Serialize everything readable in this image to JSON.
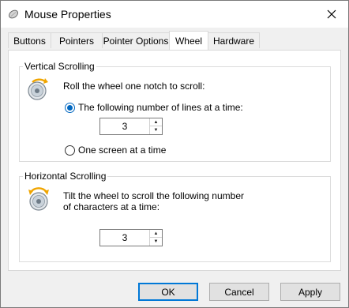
{
  "window": {
    "title": "Mouse Properties"
  },
  "tabs": [
    {
      "label": "Buttons",
      "active": false
    },
    {
      "label": "Pointers",
      "active": false
    },
    {
      "label": "Pointer Options",
      "active": false
    },
    {
      "label": "Wheel",
      "active": true
    },
    {
      "label": "Hardware",
      "active": false
    }
  ],
  "vertical": {
    "group_label": "Vertical Scrolling",
    "instruction": "Roll the wheel one notch to scroll:",
    "option_lines": {
      "label": "The following number of lines at a time:",
      "selected": true
    },
    "lines_value": "3",
    "option_screen": {
      "label": "One screen at a time",
      "selected": false
    }
  },
  "horizontal": {
    "group_label": "Horizontal Scrolling",
    "instruction_line1": "Tilt the wheel to scroll the following number",
    "instruction_line2": "of characters at a time:",
    "chars_value": "3"
  },
  "buttons": {
    "ok": "OK",
    "cancel": "Cancel",
    "apply": "Apply"
  },
  "icons": {
    "title": "mouse-icon",
    "close": "close-icon",
    "wheel": "scroll-wheel-icon",
    "spin_up": "spin-up-arrow-icon",
    "spin_down": "spin-down-arrow-icon"
  },
  "colors": {
    "accent": "#0067c0",
    "default_button_border": "#0078d7",
    "dialog_bg": "#f0f0f0",
    "panel_bg": "#ffffff"
  }
}
